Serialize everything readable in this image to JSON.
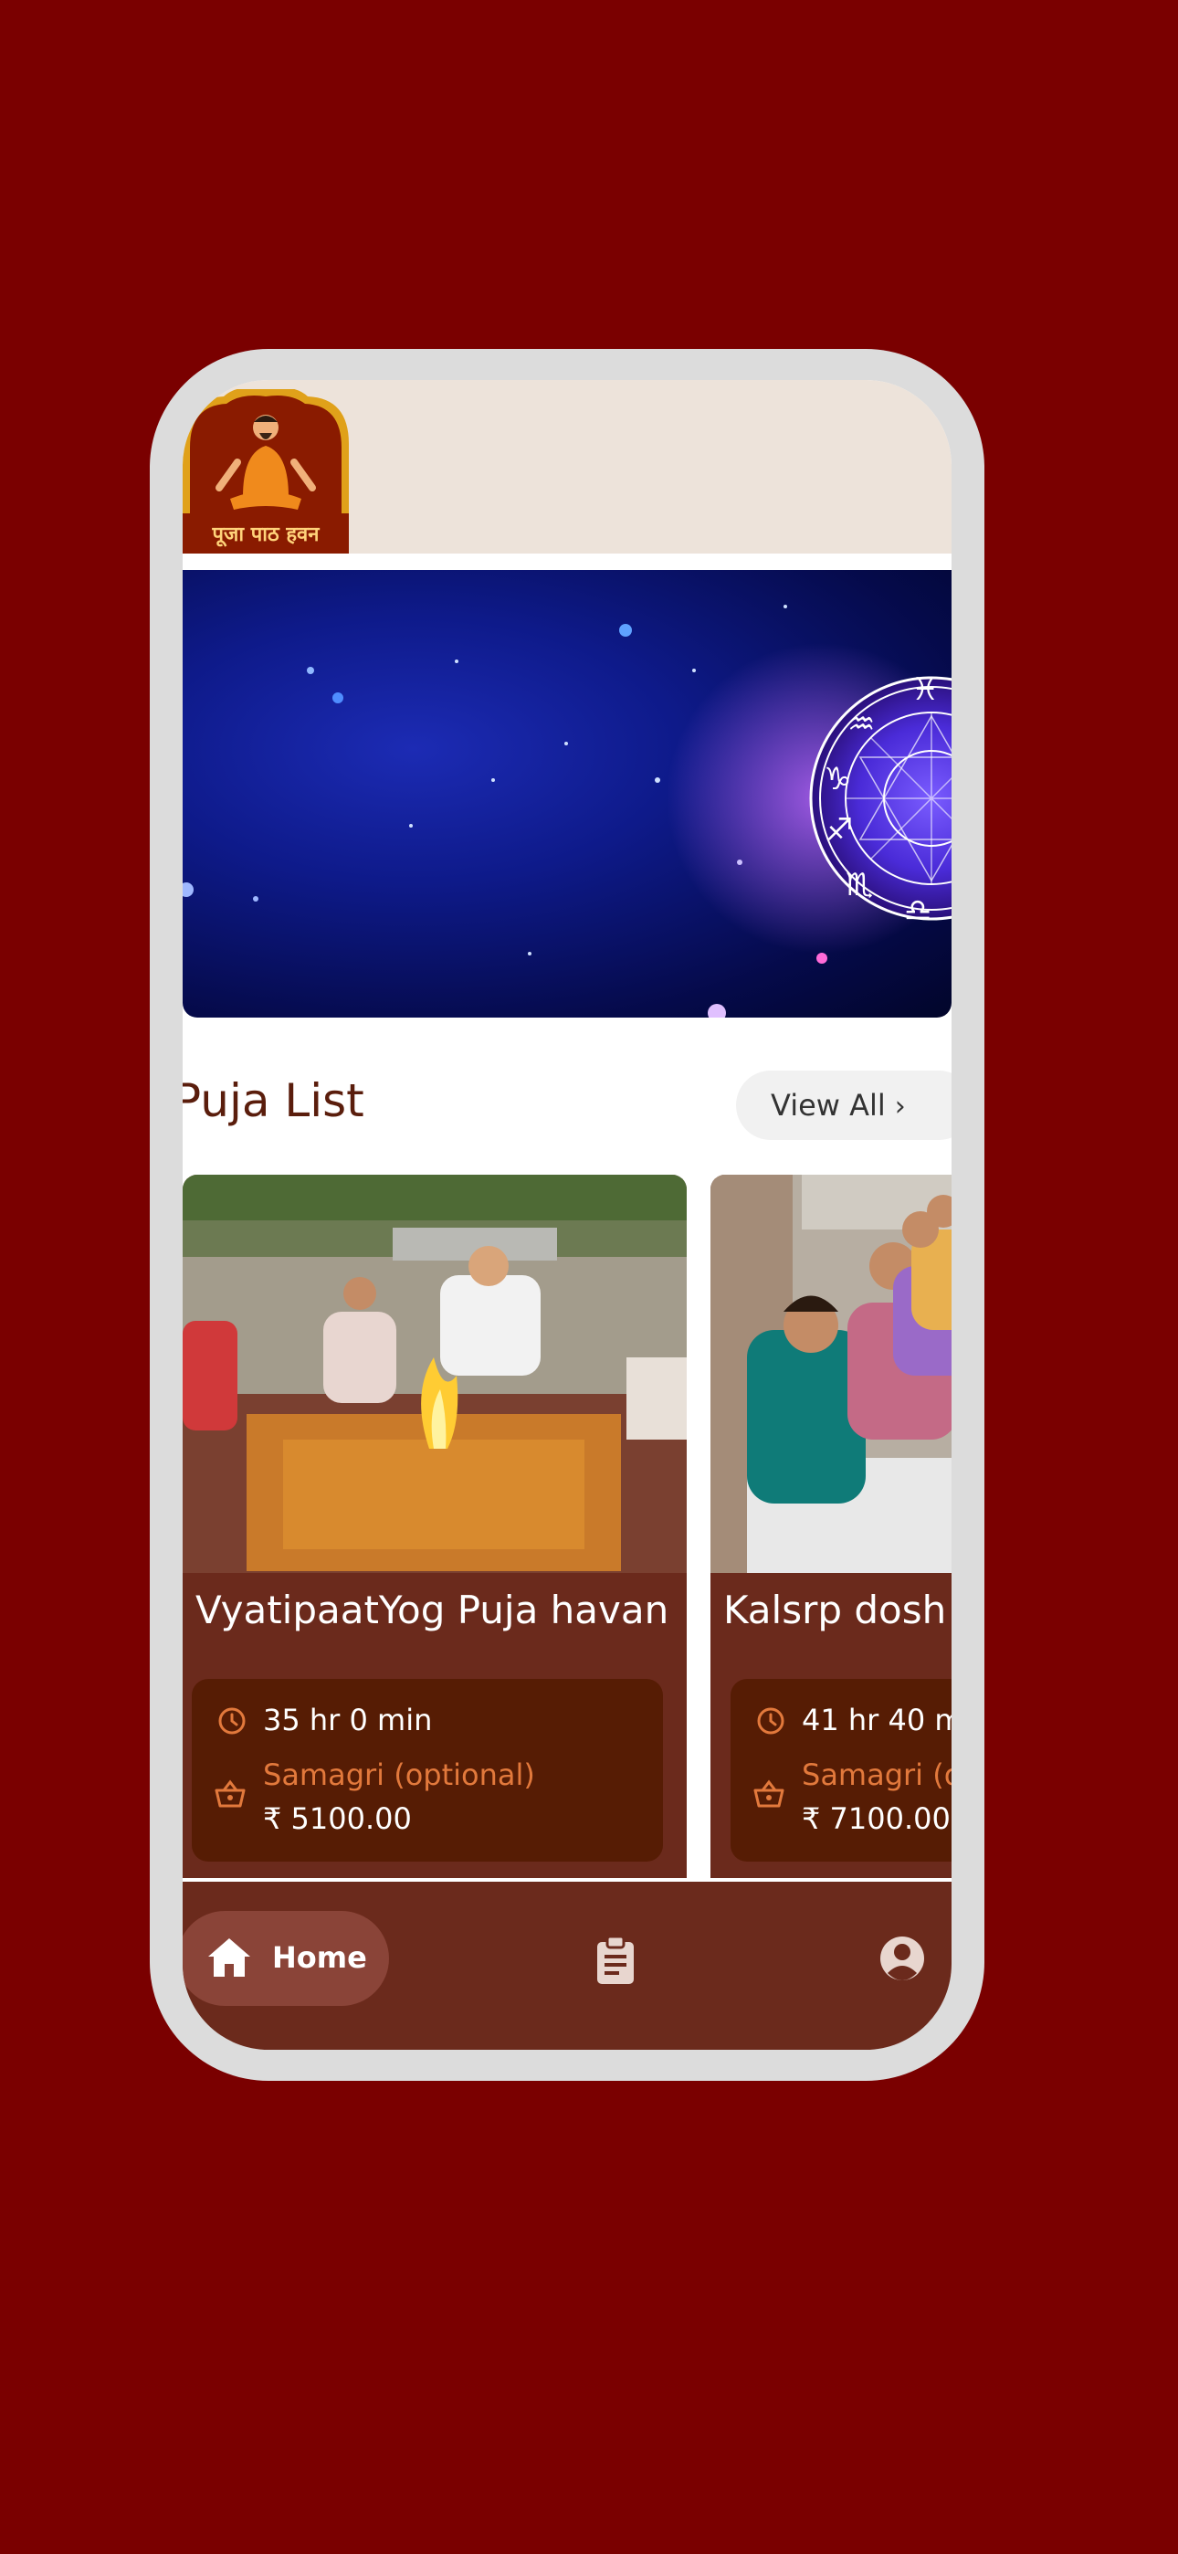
{
  "header": {
    "logo_text": "पूजा पाठ हवन"
  },
  "section": {
    "title": "Puja List",
    "view_all_label": "View All"
  },
  "pujas": [
    {
      "title": "VyatipaatYog Puja havan",
      "duration": "35 hr 0 min",
      "samagri_label": "Samagri (optional)",
      "price": "₹ 5100.00"
    },
    {
      "title": "Kalsrp dosh",
      "duration": "41 hr 40 m",
      "samagri_label": "Samagri (o",
      "price": "₹ 7100.00"
    }
  ],
  "nav": {
    "home_label": "Home"
  },
  "colors": {
    "background": "#7a0000",
    "header_bg": "#ede3da",
    "card_bg": "#6b2a1c",
    "info_bg": "#561c04",
    "accent_orange": "#e2793c"
  },
  "icons": [
    "clock-icon",
    "basket-icon",
    "home-icon",
    "clipboard-icon",
    "profile-icon",
    "chevron-right-icon"
  ]
}
